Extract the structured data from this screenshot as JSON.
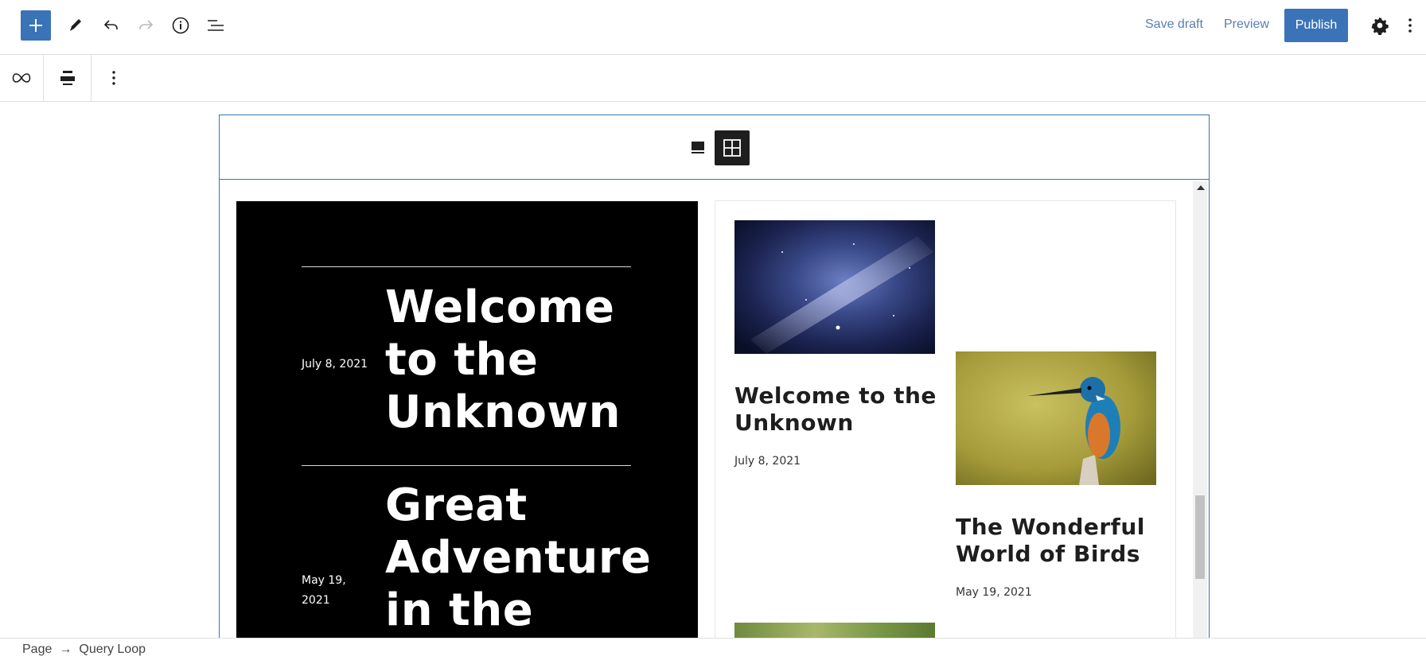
{
  "toolbar": {
    "add_label": "Add block",
    "tools_label": "Tools",
    "undo_label": "Undo",
    "redo_label": "Redo",
    "details_label": "Details",
    "list_view_label": "List view",
    "save_draft": "Save draft",
    "preview": "Preview",
    "publish": "Publish",
    "settings_label": "Settings",
    "options_label": "Options"
  },
  "block_toolbar": {
    "block_type_icon": "loop-icon",
    "align_icon": "align-center-icon",
    "more_icon": "vertical-ellipsis-icon"
  },
  "pattern_toolbar": {
    "carousel_icon": "single-view-icon",
    "grid_icon": "grid-view-icon"
  },
  "black_card": {
    "posts": [
      {
        "date": "July 8, 2021",
        "title": "Welcome to the Unknown"
      },
      {
        "date": "May 19, 2021",
        "title": "Great Adventure in the"
      }
    ]
  },
  "grid_card": {
    "posts": [
      {
        "title": "Welcome to the Unknown",
        "date": "July 8, 2021",
        "image": "galaxy-night-sky"
      },
      {
        "title": "The Wonderful World of Birds",
        "date": "May 19, 2021",
        "image": "kingfisher-bird"
      },
      {
        "title": "",
        "date": "",
        "image": "green-foliage"
      }
    ]
  },
  "breadcrumb": {
    "root": "Page",
    "separator": "→",
    "current": "Query Loop"
  },
  "colors": {
    "accent": "#3a73b8",
    "link": "#5b7fb0",
    "dark": "#1e1e1e"
  }
}
